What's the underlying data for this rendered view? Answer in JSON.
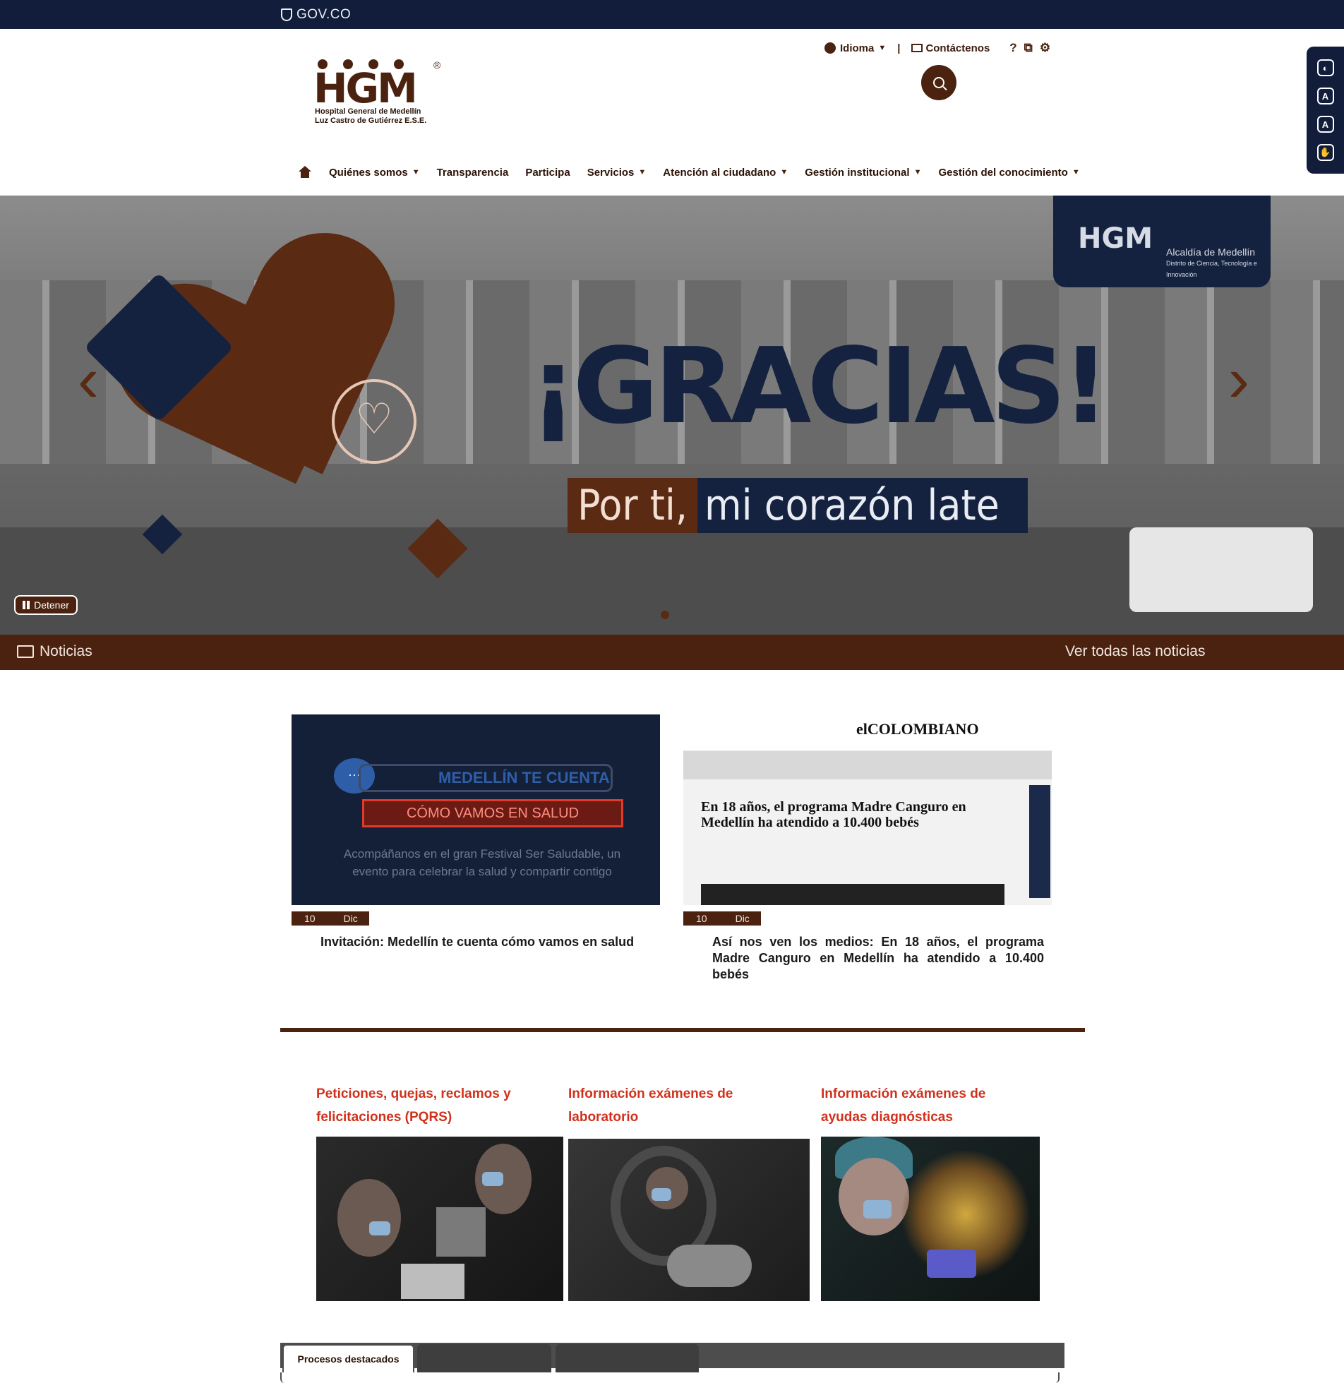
{
  "gov_bar": {
    "label": "GOV.CO"
  },
  "top_links": {
    "language": "Idioma",
    "contact": "Contáctenos"
  },
  "logo": {
    "mark": "HGM",
    "line1": "Hospital General de Medellín",
    "line2": "Luz Castro de Gutiérrez E.S.E."
  },
  "nav": {
    "items": [
      {
        "label": "Quiénes somos",
        "dropdown": true
      },
      {
        "label": "Transparencia",
        "dropdown": false
      },
      {
        "label": "Participa",
        "dropdown": false
      },
      {
        "label": "Servicios",
        "dropdown": true
      },
      {
        "label": "Atención al ciudadano",
        "dropdown": true
      },
      {
        "label": "Gestión institucional",
        "dropdown": true
      },
      {
        "label": "Gestión del conocimiento",
        "dropdown": true
      }
    ]
  },
  "hero": {
    "headline": "¡GRACIAS!",
    "tag_a": "Por ti,",
    "tag_b": "mi corazón late",
    "badge_mark": "HGM",
    "badge_org": "Alcaldía de Medellín",
    "badge_sub": "Distrito de Ciencia, Tecnología e Innovación",
    "stop_label": "Detener"
  },
  "news_bar": {
    "title": "Noticias",
    "see_all": "Ver todas las noticias"
  },
  "news": [
    {
      "day": "10",
      "month": "Dic",
      "title": "Invitación: Medellín te cuenta cómo vamos en salud",
      "img_pill": "MEDELLÍN TE CUENTA",
      "img_red": "CÓMO VAMOS EN SALUD",
      "img_body": "Acompáñanos en el gran Festival Ser Saludable, un evento para celebrar la salud y compartir contigo"
    },
    {
      "day": "10",
      "month": "Dic",
      "title": "Así nos ven los medios: En 18 años, el programa Madre Canguro en Medellín ha atendido a 10.400 bebés",
      "img_logo": "elCOLOMBIANO",
      "img_headline": "En 18 años, el programa Madre Canguro en Medellín ha atendido a 10.400 bebés"
    }
  ],
  "services": [
    {
      "title": "Peticiones, quejas, reclamos y felicitaciones (PQRS)"
    },
    {
      "title": "Información exámenes de laboratorio"
    },
    {
      "title": "Información exámenes de ayudas diagnósticas"
    }
  ],
  "tabs": {
    "active": "Procesos destacados",
    "second": "",
    "third": ""
  },
  "colors": {
    "brand_brown": "#4a220f",
    "navy": "#111d3a",
    "accent_red": "#d0311c"
  }
}
